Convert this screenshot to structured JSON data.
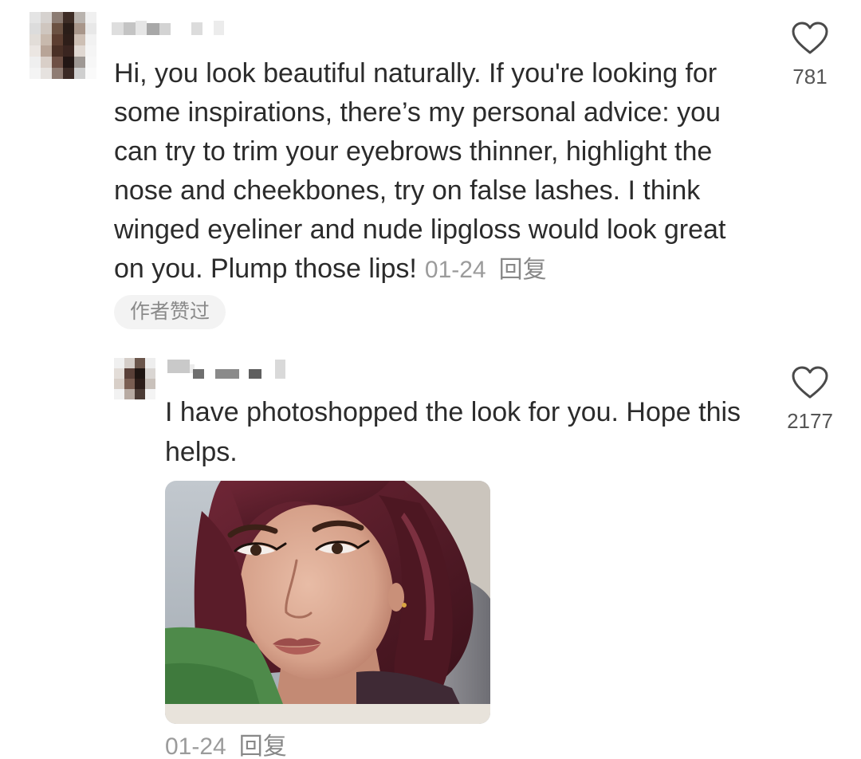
{
  "comment": {
    "avatar_icon": "pixelated-avatar",
    "text_lines": [
      "Hi, you look beautiful naturally. If you're looking for",
      "some inspirations, there’s my personal advice: you",
      "can try to trim your eyebrows thinner, highlight the",
      "nose and cheekbones, try on false lashes. I think",
      "winged eyeliner and nude lipgloss would look great",
      "on you. Plump those lips!"
    ],
    "time": "01-24",
    "reply_label": "回复",
    "badge": "作者赞过",
    "like_icon": "heart-outline-icon",
    "likes": "781"
  },
  "reply": {
    "avatar_icon": "pixelated-avatar",
    "text_lines": [
      "I have photoshopped the look for you. Hope this",
      "helps."
    ],
    "like_icon": "heart-outline-icon",
    "likes": "2177",
    "time": "01-24",
    "reply_label": "回复"
  },
  "colors": {
    "text": "#2b2b2b",
    "meta": "#9b9b9b",
    "icon": "#555555",
    "badge_bg": "#f3f3f3",
    "background": "#ffffff"
  }
}
